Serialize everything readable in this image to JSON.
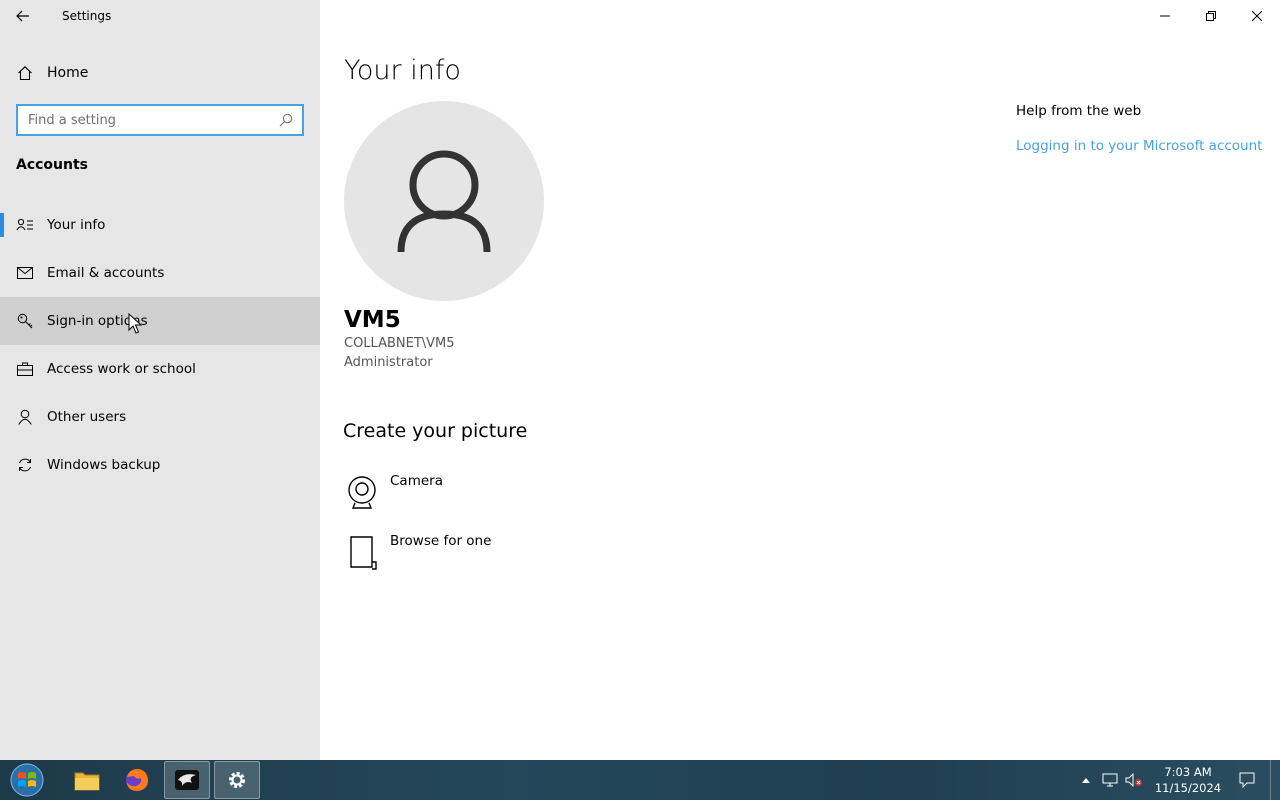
{
  "window": {
    "title": "Settings"
  },
  "sidebar": {
    "home_label": "Home",
    "search_placeholder": "Find a setting",
    "section": "Accounts",
    "items": [
      {
        "label": "Your info",
        "icon": "your-info-icon"
      },
      {
        "label": "Email & accounts",
        "icon": "mail-icon"
      },
      {
        "label": "Sign-in options",
        "icon": "key-icon"
      },
      {
        "label": "Access work or school",
        "icon": "briefcase-icon"
      },
      {
        "label": "Other users",
        "icon": "person-icon"
      },
      {
        "label": "Windows backup",
        "icon": "sync-icon"
      }
    ],
    "selected_index": 0,
    "hovered_index": 2
  },
  "main": {
    "title": "Your info",
    "user": {
      "name": "VM5",
      "domain": "COLLABNET\\VM5",
      "role": "Administrator"
    },
    "create_picture": {
      "title": "Create your picture",
      "options": [
        {
          "label": "Camera",
          "icon": "camera-icon"
        },
        {
          "label": "Browse for one",
          "icon": "browse-file-icon"
        }
      ]
    },
    "help": {
      "title": "Help from the web",
      "link": "Logging in to your Microsoft account"
    }
  },
  "taskbar": {
    "apps": [
      "file-explorer-icon",
      "firefox-icon",
      "app-icon",
      "settings-gear-icon"
    ],
    "clock_time": "7:03 AM",
    "clock_date": "11/15/2024"
  },
  "colors": {
    "accent": "#2b8ce2",
    "link": "#4aa3df",
    "sidebar_bg": "#e6e6e6",
    "hover_bg": "#cfcfcf"
  }
}
